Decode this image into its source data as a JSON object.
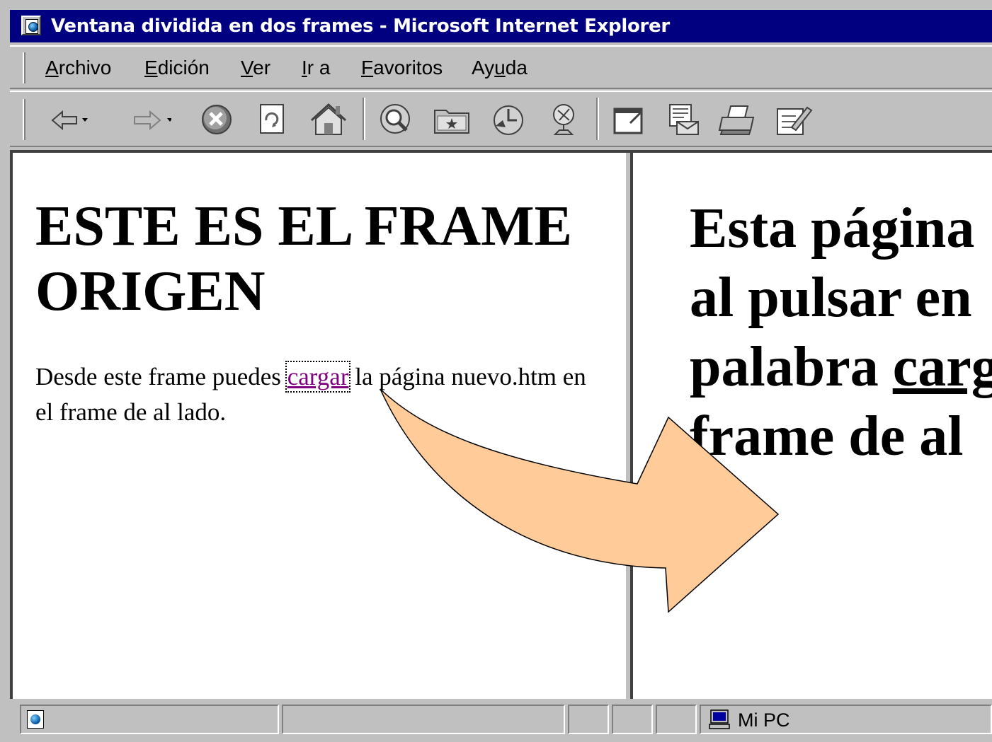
{
  "window": {
    "title": "Ventana dividida en dos frames - Microsoft Internet Explorer"
  },
  "menu": {
    "items": [
      {
        "label": "Archivo",
        "accel": "A"
      },
      {
        "label": "Edición",
        "accel": "E"
      },
      {
        "label": "Ver",
        "accel": "V"
      },
      {
        "label": "Ir a",
        "accel": "I"
      },
      {
        "label": "Favoritos",
        "accel": "F"
      },
      {
        "label": "Ayuda",
        "accel": "u"
      }
    ]
  },
  "toolbar": {
    "buttons": [
      "back-icon",
      "forward-icon",
      "stop-icon",
      "refresh-icon",
      "home-icon",
      "search-icon",
      "favorites-icon",
      "history-icon",
      "channels-icon",
      "fullscreen-icon",
      "mail-icon",
      "print-icon",
      "edit-icon"
    ]
  },
  "left_frame": {
    "heading": "ESTE ES EL FRAME ORIGEN",
    "text_before": "Desde este frame puedes ",
    "link": "cargar",
    "text_after": " la página nuevo.htm en el frame de al lado."
  },
  "right_frame": {
    "line1": "Esta página",
    "line2": "al pulsar en",
    "line3_prefix": "palabra ",
    "line3_underlined": "carg",
    "line4": "frame de al"
  },
  "annotation": {
    "arrow_color": "#ffcc99"
  },
  "statusbar": {
    "zone": "Mi PC"
  }
}
